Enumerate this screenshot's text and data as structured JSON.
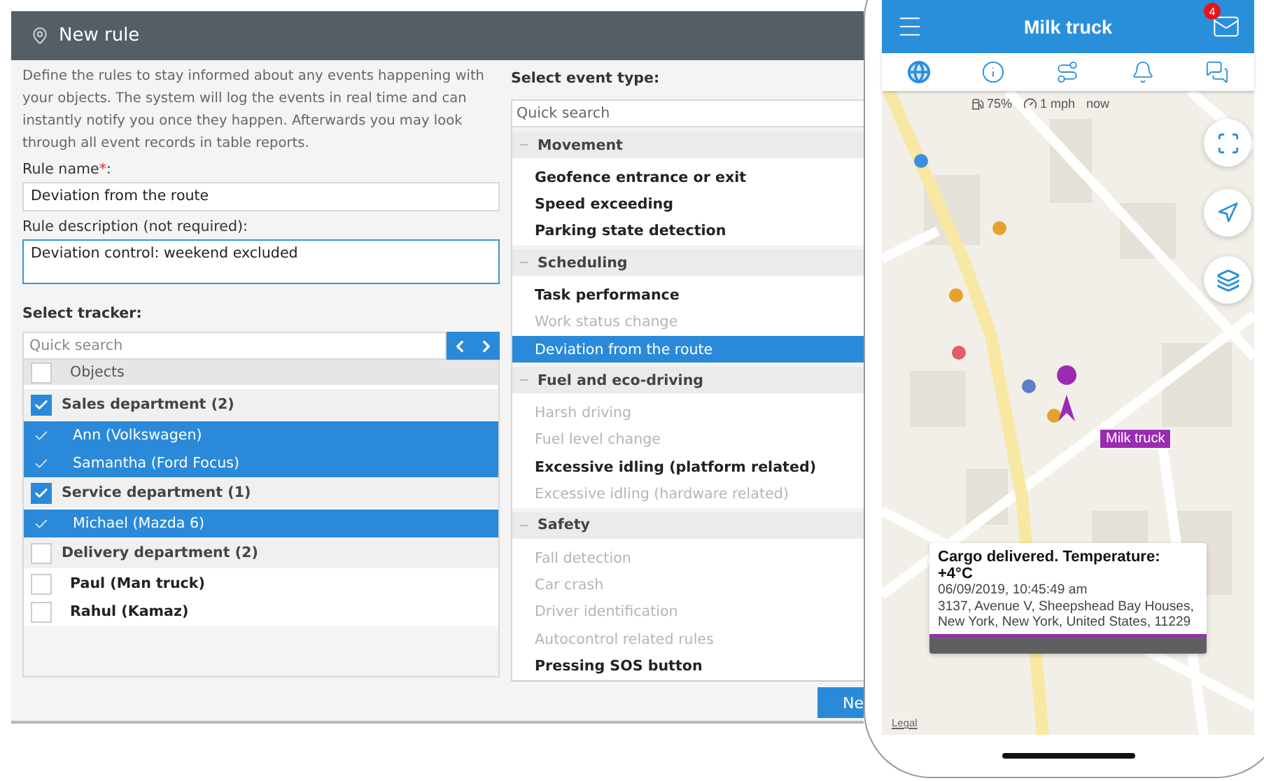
{
  "dialog": {
    "title": "New rule",
    "description": "Define the rules to stay informed about any events happening with your objects. The system will log the events in real time and can instantly notify you once they happen. Afterwards you may look through all event records in table reports.",
    "rule_name": {
      "label": "Rule name",
      "required_mark": "*",
      "label_end": ":",
      "value": "Deviation from the route"
    },
    "rule_description": {
      "label": "Rule description (not required):",
      "value": "Deviation control: weekend excluded",
      "focused": true
    },
    "tracker": {
      "label": "Select tracker:",
      "search_placeholder": "Quick search",
      "header": {
        "label": "Objects",
        "checked": false
      },
      "groups": [
        {
          "label": "Sales department (2)",
          "checked": true,
          "children": [
            {
              "label": "Ann (Volkswagen)",
              "selected": true
            },
            {
              "label": "Samantha (Ford Focus)",
              "selected": true
            }
          ]
        },
        {
          "label": "Service department (1)",
          "checked": true,
          "children": [
            {
              "label": "Michael (Mazda 6)",
              "selected": true
            }
          ]
        },
        {
          "label": "Delivery department (2)",
          "checked": false,
          "children": [
            {
              "label": "Paul (Man truck)",
              "selected": false
            },
            {
              "label": "Rahul (Kamaz)",
              "selected": false
            }
          ]
        }
      ]
    },
    "events": {
      "label": "Select event type:",
      "search_placeholder": "Quick search",
      "categories": [
        {
          "label": "Movement",
          "expanded": true,
          "items": [
            {
              "label": "Geofence entrance or exit",
              "disabled": false,
              "selected": false
            },
            {
              "label": "Speed exceeding",
              "disabled": false,
              "selected": false
            },
            {
              "label": "Parking state detection",
              "disabled": false,
              "selected": false
            }
          ]
        },
        {
          "label": "Scheduling",
          "expanded": true,
          "items": [
            {
              "label": "Task performance",
              "disabled": false,
              "selected": false
            },
            {
              "label": "Work status change",
              "disabled": true,
              "selected": false
            },
            {
              "label": "Deviation from the route",
              "disabled": false,
              "selected": true
            }
          ]
        },
        {
          "label": "Fuel and eco-driving",
          "expanded": true,
          "items": [
            {
              "label": "Harsh driving",
              "disabled": true,
              "selected": false
            },
            {
              "label": "Fuel level change",
              "disabled": true,
              "selected": false
            },
            {
              "label": "Excessive idling (platform related)",
              "disabled": false,
              "selected": false
            },
            {
              "label": "Excessive idling (hardware related)",
              "disabled": true,
              "selected": false
            }
          ]
        },
        {
          "label": "Safety",
          "expanded": true,
          "items": [
            {
              "label": "Fall detection",
              "disabled": true,
              "selected": false
            },
            {
              "label": "Car crash",
              "disabled": true,
              "selected": false
            },
            {
              "label": "Driver identification",
              "disabled": true,
              "selected": false
            },
            {
              "label": "Autocontrol related rules",
              "disabled": true,
              "selected": false
            },
            {
              "label": "Pressing SOS button",
              "disabled": false,
              "selected": false
            }
          ]
        }
      ]
    },
    "next_button": "Ne"
  },
  "phone": {
    "title": "Milk truck",
    "unread_count": "4",
    "tabs": [
      {
        "kind": "globe",
        "selected": true
      },
      {
        "kind": "info",
        "selected": false
      },
      {
        "kind": "route",
        "selected": false
      },
      {
        "kind": "bell",
        "selected": false
      },
      {
        "kind": "chat",
        "selected": false
      }
    ],
    "status": {
      "battery": "75%",
      "speed": "1 mph",
      "time": "now"
    },
    "marker_label": "Milk truck",
    "card": {
      "title": "Cargo delivered. Temperature: +4°C",
      "time": "06/09/2019, 10:45:49 am",
      "address": "3137, Avenue V, Sheepshead Bay Houses, New York, New York, United States, 11229"
    },
    "legal": "Legal"
  }
}
